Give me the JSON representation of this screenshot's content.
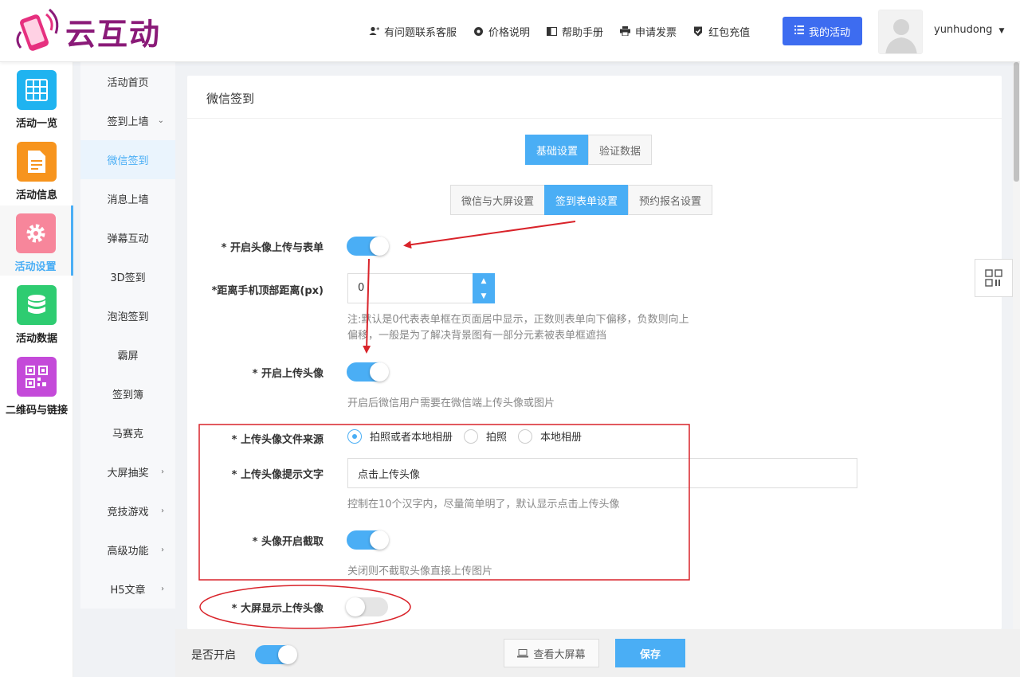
{
  "brand": {
    "name": "云互动"
  },
  "topnav": [
    {
      "label": "有问题联系客服",
      "icon": "add-user-icon"
    },
    {
      "label": "价格说明",
      "icon": "gear-icon"
    },
    {
      "label": "帮助手册",
      "icon": "book-icon"
    },
    {
      "label": "申请发票",
      "icon": "printer-icon"
    },
    {
      "label": "红包充值",
      "icon": "shield-check-icon"
    }
  ],
  "my_activity": "我的活动",
  "user": {
    "name": "yunhudong"
  },
  "iconnav": [
    {
      "label": "活动一览",
      "icon": "grid-icon",
      "color": "#1fb3f0"
    },
    {
      "label": "活动信息",
      "icon": "document-icon",
      "color": "#f7941d"
    },
    {
      "label": "活动设置",
      "icon": "gear-icon",
      "color": "#f7869b",
      "active": true
    },
    {
      "label": "活动数据",
      "icon": "database-icon",
      "color": "#2ecc71"
    },
    {
      "label": "二维码与链接",
      "icon": "qrcode-icon",
      "color": "#c44ad9"
    }
  ],
  "subnav": [
    {
      "label": "活动首页"
    },
    {
      "label": "签到上墙",
      "arrow": "⌄"
    },
    {
      "label": "微信签到",
      "active": true
    },
    {
      "label": "消息上墙"
    },
    {
      "label": "弹幕互动"
    },
    {
      "label": "3D签到"
    },
    {
      "label": "泡泡签到"
    },
    {
      "label": "霸屏"
    },
    {
      "label": "签到簿"
    },
    {
      "label": "马赛克"
    },
    {
      "label": "大屏抽奖",
      "arrow": "›"
    },
    {
      "label": "竞技游戏",
      "arrow": "›"
    },
    {
      "label": "高级功能",
      "arrow": "›"
    },
    {
      "label": "H5文章",
      "arrow": "›"
    }
  ],
  "panel": {
    "title": "微信签到",
    "tabs_main": [
      {
        "label": "基础设置",
        "active": true
      },
      {
        "label": "验证数据"
      }
    ],
    "tabs_sub": [
      {
        "label": "微信与大屏设置"
      },
      {
        "label": "签到表单设置",
        "active": true
      },
      {
        "label": "预约报名设置"
      }
    ]
  },
  "form": {
    "avatar_form": {
      "label": "* 开启头像上传与表单",
      "on": true
    },
    "top_offset": {
      "label": "*距离手机顶部距离(px)",
      "value": "0",
      "hint1": "注:默认是0代表表单框在页面居中显示，正数则表单向下偏移，负数则向上",
      "hint2": "偏移，一般是为了解决背景图有一部分元素被表单框遮挡"
    },
    "upload_avatar": {
      "label": "* 开启上传头像",
      "on": true,
      "hint": "开启后微信用户需要在微信端上传头像或图片"
    },
    "source": {
      "label": "* 上传头像文件来源",
      "options": [
        {
          "label": "拍照或者本地相册",
          "checked": true
        },
        {
          "label": "拍照"
        },
        {
          "label": "本地相册"
        }
      ]
    },
    "prompt": {
      "label": "* 上传头像提示文字",
      "value": "点击上传头像",
      "hint": "控制在10个汉字内，尽量简单明了，默认显示点击上传头像"
    },
    "crop": {
      "label": "* 头像开启截取",
      "on": true,
      "hint": "关闭则不截取头像直接上传图片"
    },
    "bigscreen": {
      "label": "* 大屏显示上传头像",
      "on": false
    }
  },
  "footer": {
    "enable_label": "是否开启",
    "enable_on": true,
    "screen_btn": "查看大屏幕",
    "save_btn": "保存"
  },
  "colors": {
    "accent": "#4aaef5",
    "primary_blue": "#3d6cf0",
    "annotation_red": "#d9232a",
    "brand": "#8a1a78"
  }
}
